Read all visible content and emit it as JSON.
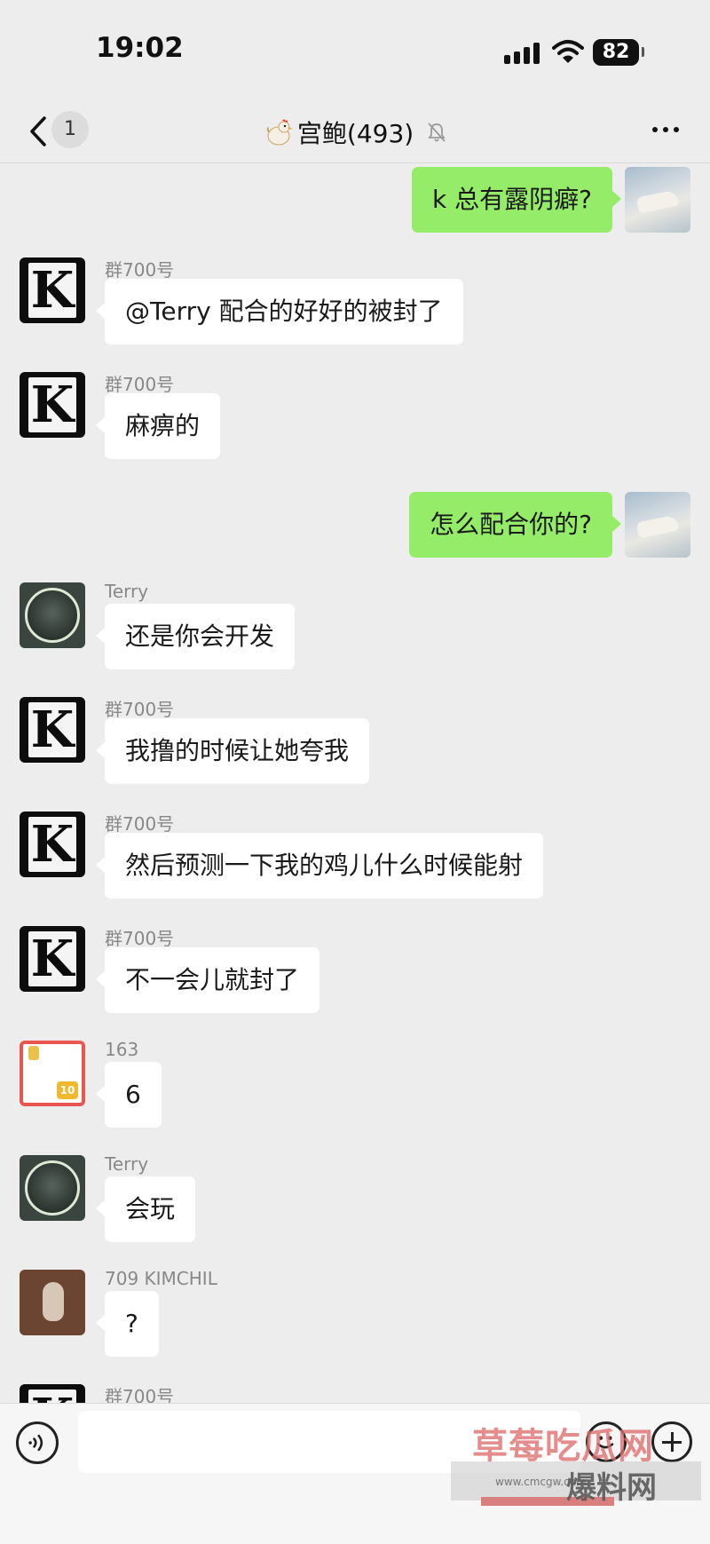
{
  "status_bar": {
    "time": "19:02",
    "battery": "82"
  },
  "nav": {
    "back_count": "1",
    "title": "宫鲍(493)"
  },
  "messages": [
    {
      "side": "out",
      "text": "k 总有露阴癖?"
    },
    {
      "side": "in",
      "sender": "群700号",
      "avatar": "k-avatar",
      "text": "@Terry 配合的好好的被封了"
    },
    {
      "side": "in",
      "sender": "群700号",
      "avatar": "k-avatar",
      "text": "麻痹的"
    },
    {
      "side": "out",
      "text": "怎么配合你的?"
    },
    {
      "side": "in",
      "sender": "Terry",
      "avatar": "terry-avatar",
      "text": "还是你会开发"
    },
    {
      "side": "in",
      "sender": "群700号",
      "avatar": "k-avatar",
      "text": "我撸的时候让她夸我"
    },
    {
      "side": "in",
      "sender": "群700号",
      "avatar": "k-avatar",
      "text": "然后预测一下我的鸡儿什么时候能射"
    },
    {
      "side": "in",
      "sender": "群700号",
      "avatar": "k-avatar",
      "text": "不一会儿就封了"
    },
    {
      "side": "in",
      "sender": "163",
      "avatar": "163-avatar",
      "text": "6"
    },
    {
      "side": "in",
      "sender": "Terry",
      "avatar": "terry-avatar",
      "text": "会玩"
    },
    {
      "side": "in",
      "sender": "709 KIMCHIL",
      "avatar": "cat-avatar",
      "text": "?"
    },
    {
      "side": "in",
      "sender": "群700号",
      "avatar": "k-avatar",
      "text": ""
    }
  ],
  "watermark": {
    "top": "草莓吃瓜网",
    "sub": "爆料网",
    "url": "www.cmcgw.com"
  },
  "colors": {
    "bg": "#ededed",
    "bubble_out": "#95ec69",
    "bubble_in": "#ffffff"
  }
}
